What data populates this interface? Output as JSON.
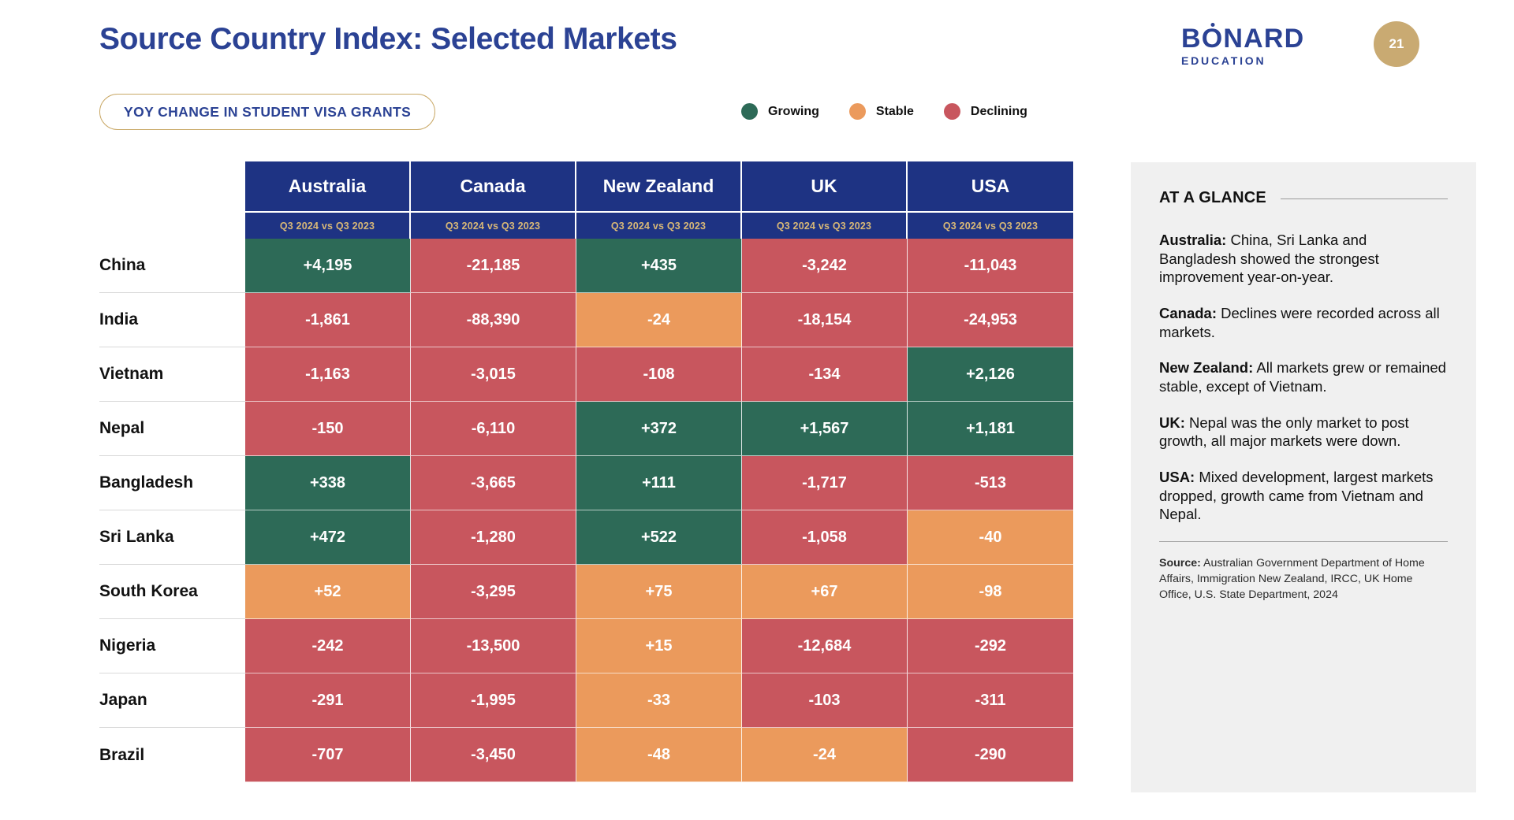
{
  "header": {
    "title": "Source Country Index: Selected Markets",
    "pill_label": "YOY CHANGE IN STUDENT VISA GRANTS",
    "brand_name": "BONARD",
    "brand_sub": "EDUCATION",
    "page_number": "21"
  },
  "legend": {
    "items": [
      {
        "label": "Growing",
        "color": "#2d6a57"
      },
      {
        "label": "Stable",
        "color": "#eb9a5c"
      },
      {
        "label": "Declining",
        "color": "#c8565e"
      }
    ]
  },
  "colors": {
    "brand_blue": "#2b4294",
    "header_blue": "#1e3383",
    "gold": "#c9aa72",
    "period_gold": "#d8b877",
    "growing": "#2d6a57",
    "stable": "#eb9a5c",
    "declining": "#c8565e",
    "panel_bg": "#f0f0f0"
  },
  "chart_data": {
    "type": "heatmap",
    "title": "Source Country Index: Selected Markets",
    "subtitle": "YOY CHANGE IN STUDENT VISA GRANTS",
    "xlabel": "",
    "ylabel": "",
    "legend_position": "top-right",
    "period_label": "Q3 2024 vs Q3 2023",
    "columns": [
      "Australia",
      "Canada",
      "New Zealand",
      "UK",
      "USA"
    ],
    "column_subheaders": [
      "Q3 2024 vs Q3 2023",
      "Q3 2024 vs Q3 2023",
      "Q3 2024 vs Q3 2023",
      "Q3 2024 vs Q3 2023",
      "Q3 2024 vs Q3 2023"
    ],
    "categories": [
      "China",
      "India",
      "Vietnam",
      "Nepal",
      "Bangladesh",
      "Sri Lanka",
      "South Korea",
      "Nigeria",
      "Japan",
      "Brazil"
    ],
    "rows": [
      {
        "label": "China",
        "cells": [
          {
            "text": "+4,195",
            "value": 4195,
            "state": "growing"
          },
          {
            "text": "-21,185",
            "value": -21185,
            "state": "declining"
          },
          {
            "text": "+435",
            "value": 435,
            "state": "growing"
          },
          {
            "text": "-3,242",
            "value": -3242,
            "state": "declining"
          },
          {
            "text": "-11,043",
            "value": -11043,
            "state": "declining"
          }
        ]
      },
      {
        "label": "India",
        "cells": [
          {
            "text": "-1,861",
            "value": -1861,
            "state": "declining"
          },
          {
            "text": "-88,390",
            "value": -88390,
            "state": "declining"
          },
          {
            "text": "-24",
            "value": -24,
            "state": "stable"
          },
          {
            "text": "-18,154",
            "value": -18154,
            "state": "declining"
          },
          {
            "text": "-24,953",
            "value": -24953,
            "state": "declining"
          }
        ]
      },
      {
        "label": "Vietnam",
        "cells": [
          {
            "text": "-1,163",
            "value": -1163,
            "state": "declining"
          },
          {
            "text": "-3,015",
            "value": -3015,
            "state": "declining"
          },
          {
            "text": "-108",
            "value": -108,
            "state": "declining"
          },
          {
            "text": "-134",
            "value": -134,
            "state": "declining"
          },
          {
            "text": "+2,126",
            "value": 2126,
            "state": "growing"
          }
        ]
      },
      {
        "label": "Nepal",
        "cells": [
          {
            "text": "-150",
            "value": -150,
            "state": "declining"
          },
          {
            "text": "-6,110",
            "value": -6110,
            "state": "declining"
          },
          {
            "text": "+372",
            "value": 372,
            "state": "growing"
          },
          {
            "text": "+1,567",
            "value": 1567,
            "state": "growing"
          },
          {
            "text": "+1,181",
            "value": 1181,
            "state": "growing"
          }
        ]
      },
      {
        "label": "Bangladesh",
        "cells": [
          {
            "text": "+338",
            "value": 338,
            "state": "growing"
          },
          {
            "text": "-3,665",
            "value": -3665,
            "state": "declining"
          },
          {
            "text": "+111",
            "value": 111,
            "state": "growing"
          },
          {
            "text": "-1,717",
            "value": -1717,
            "state": "declining"
          },
          {
            "text": "-513",
            "value": -513,
            "state": "declining"
          }
        ]
      },
      {
        "label": "Sri Lanka",
        "cells": [
          {
            "text": "+472",
            "value": 472,
            "state": "growing"
          },
          {
            "text": "-1,280",
            "value": -1280,
            "state": "declining"
          },
          {
            "text": "+522",
            "value": 522,
            "state": "growing"
          },
          {
            "text": "-1,058",
            "value": -1058,
            "state": "declining"
          },
          {
            "text": "-40",
            "value": -40,
            "state": "stable"
          }
        ]
      },
      {
        "label": "South Korea",
        "cells": [
          {
            "text": "+52",
            "value": 52,
            "state": "stable"
          },
          {
            "text": "-3,295",
            "value": -3295,
            "state": "declining"
          },
          {
            "text": "+75",
            "value": 75,
            "state": "stable"
          },
          {
            "text": "+67",
            "value": 67,
            "state": "stable"
          },
          {
            "text": "-98",
            "value": -98,
            "state": "stable"
          }
        ]
      },
      {
        "label": "Nigeria",
        "cells": [
          {
            "text": "-242",
            "value": -242,
            "state": "declining"
          },
          {
            "text": "-13,500",
            "value": -13500,
            "state": "declining"
          },
          {
            "text": "+15",
            "value": 15,
            "state": "stable"
          },
          {
            "text": "-12,684",
            "value": -12684,
            "state": "declining"
          },
          {
            "text": "-292",
            "value": -292,
            "state": "declining"
          }
        ]
      },
      {
        "label": "Japan",
        "cells": [
          {
            "text": "-291",
            "value": -291,
            "state": "declining"
          },
          {
            "text": "-1,995",
            "value": -1995,
            "state": "declining"
          },
          {
            "text": "-33",
            "value": -33,
            "state": "stable"
          },
          {
            "text": "-103",
            "value": -103,
            "state": "declining"
          },
          {
            "text": "-311",
            "value": -311,
            "state": "declining"
          }
        ]
      },
      {
        "label": "Brazil",
        "cells": [
          {
            "text": "-707",
            "value": -707,
            "state": "declining"
          },
          {
            "text": "-3,450",
            "value": -3450,
            "state": "declining"
          },
          {
            "text": "-48",
            "value": -48,
            "state": "stable"
          },
          {
            "text": "-24",
            "value": -24,
            "state": "stable"
          },
          {
            "text": "-290",
            "value": -290,
            "state": "declining"
          }
        ]
      }
    ]
  },
  "glance": {
    "title": "AT A GLANCE",
    "notes": [
      {
        "market": "Australia:",
        "text": " China, Sri Lanka and Bangladesh showed the strongest improvement year-on-year."
      },
      {
        "market": "Canada:",
        "text": " Declines were recorded across all markets."
      },
      {
        "market": "New Zealand:",
        "text": " All markets grew or remained stable, except of Vietnam."
      },
      {
        "market": "UK:",
        "text": " Nepal was the only market to post growth, all major markets were down."
      },
      {
        "market": "USA:",
        "text": " Mixed development, largest markets dropped, growth came from Vietnam and Nepal."
      }
    ],
    "source_label": "Source:",
    "source_text": " Australian Government Department of Home Affairs, Immigration New Zealand, IRCC, UK Home Office, U.S. State Department, 2024"
  }
}
